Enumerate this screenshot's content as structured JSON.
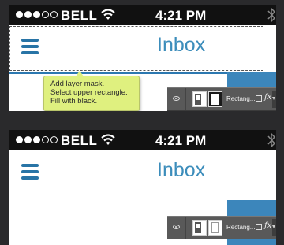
{
  "status": {
    "carrier": "BELL",
    "time": "4:21 PM",
    "signal_bars": 5,
    "signal_filled": 3
  },
  "header": {
    "title": "Inbox"
  },
  "tooltip": {
    "lines": [
      "Add layer mask.",
      "Select upper rectangle.",
      "Fill with black."
    ]
  },
  "layer": {
    "name": "Rectang...",
    "fx": "fx"
  },
  "colors": {
    "accent": "#3c8dbb",
    "blue_block": "#3c86bb",
    "tooltip_bg": "#dff07f",
    "statusbar": "#111111"
  }
}
